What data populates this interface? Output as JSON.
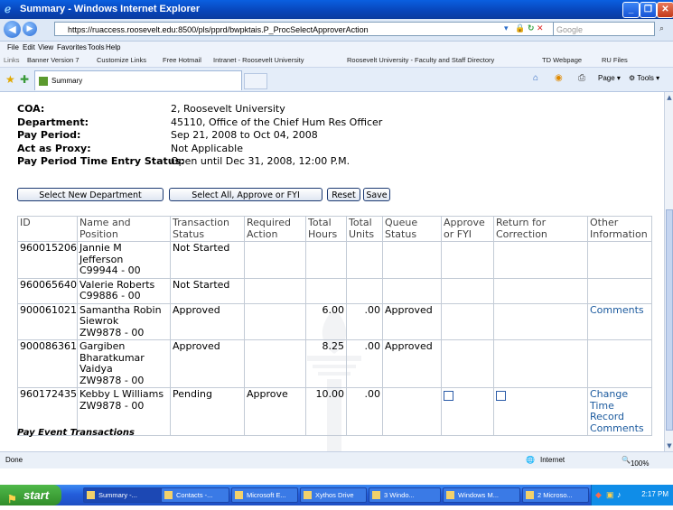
{
  "window": {
    "title": "Summary - Windows Internet Explorer"
  },
  "address": {
    "url": "https://ruaccess.roosevelt.edu:8500/pls/pprd/bwpktais.P_ProcSelectApproverAction",
    "search_placeholder": "Google"
  },
  "menu": [
    "File",
    "Edit",
    "View",
    "Favorites",
    "Tools",
    "Help"
  ],
  "links": {
    "label": "Links",
    "items": [
      "Banner Version 7",
      "Customize Links",
      "Free Hotmail",
      "Intranet - Roosevelt University",
      "Roosevelt University - Faculty and Staff Directory",
      "TD Webpage",
      "RU Files"
    ]
  },
  "tab": {
    "title": "Summary"
  },
  "commands": {
    "page": "Page",
    "tools": "Tools"
  },
  "info": [
    {
      "label": "COA:",
      "value": "2, Roosevelt University"
    },
    {
      "label": "Department:",
      "value": "45110, Office of the Chief Hum Res Officer"
    },
    {
      "label": "Pay Period:",
      "value": "Sep 21, 2008 to Oct 04, 2008"
    },
    {
      "label": "Act as Proxy:",
      "value": "Not Applicable"
    },
    {
      "label": "Pay Period Time Entry Status:",
      "value": "Open until Dec 31, 2008, 12:00 P.M."
    }
  ],
  "buttons": {
    "select_dept": "Select New Department",
    "select_all": "Select All, Approve or FYI",
    "reset": "Reset",
    "save": "Save"
  },
  "table": {
    "headers": [
      "ID",
      "Name and Position",
      "Transaction Status",
      "Required Action",
      "Total Hours",
      "Total Units",
      "Queue Status",
      "Approve or FYI",
      "Return for Correction",
      "Other Information"
    ],
    "rows": [
      {
        "id": "960015206",
        "name": "Jannie M Jefferson",
        "position": "C99944 - 00",
        "status": "Not Started",
        "action": "",
        "hours": "",
        "units": "",
        "queue": "",
        "approve_box": false,
        "return_box": false,
        "other": ""
      },
      {
        "id": "960065640",
        "name": "Valerie Roberts",
        "position": "C99886 - 00",
        "status": "Not Started",
        "action": "",
        "hours": "",
        "units": "",
        "queue": "",
        "approve_box": false,
        "return_box": false,
        "other": ""
      },
      {
        "id": "900061021",
        "name": "Samantha Robin Siewrok",
        "position": "ZW9878 - 00",
        "status": "Approved",
        "action": "",
        "hours": "6.00",
        "units": ".00",
        "queue": "Approved",
        "approve_box": false,
        "return_box": false,
        "other": "Comments"
      },
      {
        "id": "900086361",
        "name": "Gargiben Bharatkumar Vaidya",
        "position": "ZW9878 - 00",
        "status": "Approved",
        "action": "",
        "hours": "8.25",
        "units": ".00",
        "queue": "Approved",
        "approve_box": false,
        "return_box": false,
        "other": ""
      },
      {
        "id": "960172435",
        "name": "Kebby L Williams",
        "position": "ZW9878 - 00",
        "status": "Pending",
        "action": "Approve",
        "hours": "10.00",
        "units": ".00",
        "queue": "",
        "approve_box": true,
        "return_box": true,
        "other": "Change Time Record Comments"
      }
    ]
  },
  "footer_title": "Pay Event Transactions",
  "status": {
    "left": "Done",
    "zone": "Internet",
    "zoom": "100%"
  },
  "taskbar": {
    "start": "start",
    "tasks": [
      "Summary -...",
      "Contacts -...",
      "Microsoft E...",
      "Xythos Drive",
      "3 Windo...",
      "Windows M...",
      "2 Microso..."
    ],
    "clock": "2:17 PM"
  },
  "colors": {
    "titlebar": "#0a4fd0",
    "link": "#1b5a9e",
    "taskbar": "#245edb",
    "start": "#3c9a35"
  }
}
